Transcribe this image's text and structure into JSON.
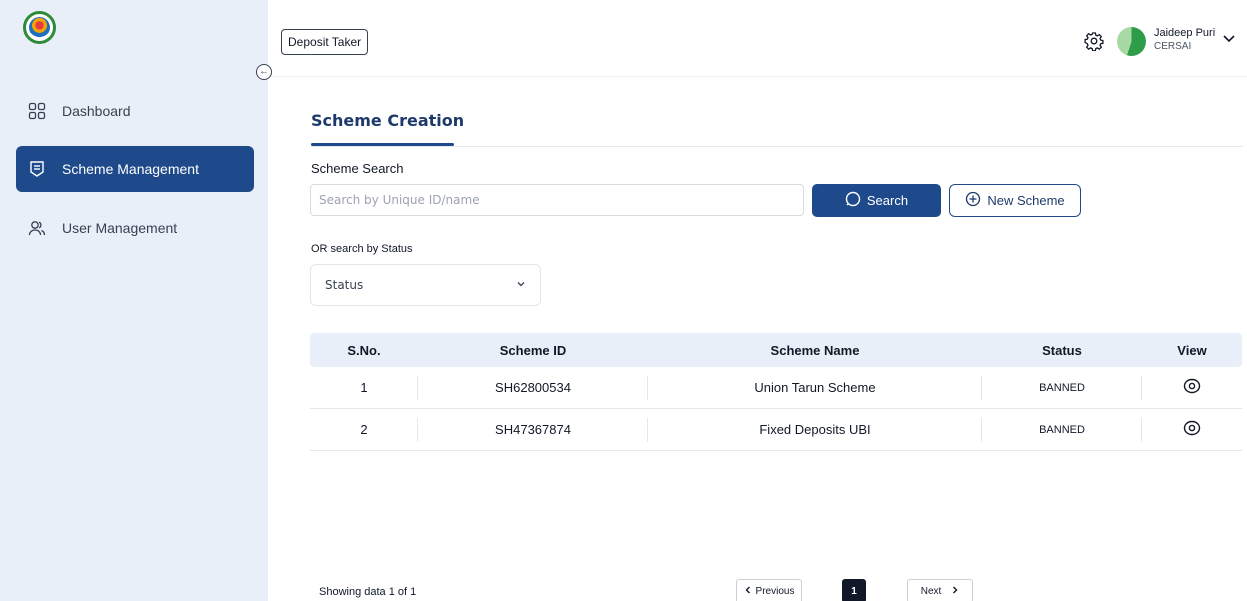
{
  "sidebar": {
    "items": [
      {
        "label": "Dashboard",
        "icon": "grid-icon"
      },
      {
        "label": "Scheme Management",
        "icon": "list-icon",
        "active": true
      },
      {
        "label": "User Management",
        "icon": "users-icon"
      }
    ]
  },
  "header": {
    "role": "Deposit Taker",
    "user_name": "Jaideep Puri",
    "user_org": "CERSAI"
  },
  "main": {
    "title": "Scheme Creation",
    "search_label": "Scheme Search",
    "search_placeholder": "Search by Unique ID/name",
    "search_button": "Search",
    "new_button": "New Scheme",
    "status_label": "OR search by Status",
    "status_value": "Status"
  },
  "table": {
    "headers": [
      "S.No.",
      "Scheme ID",
      "Scheme Name",
      "Status",
      "View"
    ],
    "rows": [
      {
        "sno": "1",
        "scheme_id": "SH62800534",
        "name": "Union Tarun Scheme",
        "status": "BANNED"
      },
      {
        "sno": "2",
        "scheme_id": "SH47367874",
        "name": "Fixed Deposits UBI",
        "status": "BANNED"
      }
    ]
  },
  "footer": {
    "showing": "Showing data  1 of 1",
    "previous": "Previous",
    "page": "1",
    "next": "Next"
  },
  "colors": {
    "primary": "#1e4a8b",
    "sidebar_bg": "#e9eff8",
    "table_header_bg": "#e9eff8"
  }
}
